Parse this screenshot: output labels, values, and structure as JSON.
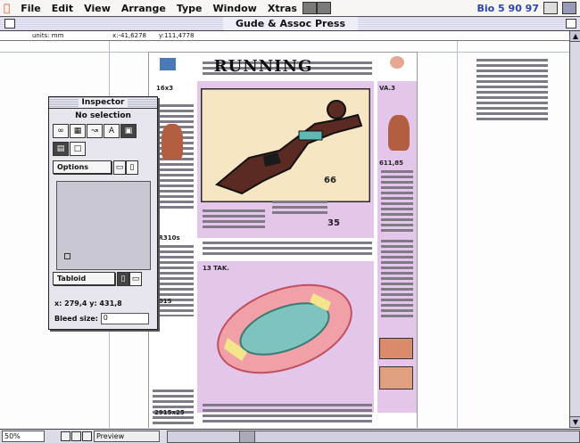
{
  "menubar": {
    "apple": "",
    "items": [
      "File",
      "Edit",
      "View",
      "Arrange",
      "Type",
      "Window",
      "Xtras"
    ],
    "clock": "Bio 5 90 97"
  },
  "window": {
    "title": "Gude & Assoc Press"
  },
  "ruler": {
    "units": "units: mm",
    "x": "x:-41,6278",
    "y": "y:111,4778"
  },
  "document": {
    "headline": "RUNNING",
    "subheads": [
      "16x3",
      "VA.3",
      "611,85",
      "LR310s",
      "13 TAK.",
      "1015",
      "2915x25"
    ],
    "big_numbers": [
      "66",
      "35"
    ]
  },
  "inspector": {
    "title": "Inspector",
    "selection": "No selection",
    "options_label": "Options",
    "tabloid_label": "Tabloid",
    "coords": "x: 279,4  y: 431,8",
    "bleed_label": "Bleed size:",
    "bleed_value": "0",
    "small_letter": "A"
  },
  "statusbar": {
    "zoom": "50%",
    "view_mode": "Preview"
  },
  "colors": {
    "accent_lilac": "#e4c6ea",
    "menubar_clock": "#2a45b8",
    "apple": "#e23c1e"
  }
}
